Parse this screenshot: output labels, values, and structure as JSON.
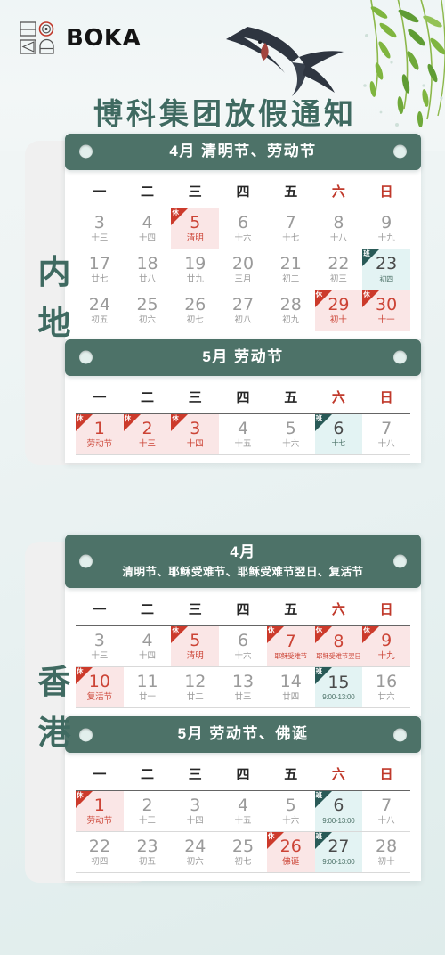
{
  "brand": {
    "name": "BOKA",
    "logo_icon": "boka-logo-icon"
  },
  "page_title": "博科集团放假通知",
  "decor": {
    "bird": "swallow-icon",
    "branch": "willow-branch-icon"
  },
  "badges": {
    "rest": "休",
    "work": "班"
  },
  "weekdays": [
    "一",
    "二",
    "三",
    "四",
    "五",
    "六",
    "日"
  ],
  "regions": [
    {
      "label": "内地",
      "calendars": [
        {
          "title_line1": "4月 清明节、劳动节",
          "title_line2": "",
          "weeks": [
            [
              {
                "num": "3",
                "sub": "十三"
              },
              {
                "num": "4",
                "sub": "十四"
              },
              {
                "num": "5",
                "sub": "清明",
                "type": "rest"
              },
              {
                "num": "6",
                "sub": "十六"
              },
              {
                "num": "7",
                "sub": "十七"
              },
              {
                "num": "8",
                "sub": "十八"
              },
              {
                "num": "9",
                "sub": "十九"
              }
            ],
            [
              {
                "num": "17",
                "sub": "廿七"
              },
              {
                "num": "18",
                "sub": "廿八"
              },
              {
                "num": "19",
                "sub": "廿九"
              },
              {
                "num": "20",
                "sub": "三月"
              },
              {
                "num": "21",
                "sub": "初二"
              },
              {
                "num": "22",
                "sub": "初三"
              },
              {
                "num": "23",
                "sub": "初四",
                "type": "work"
              }
            ],
            [
              {
                "num": "24",
                "sub": "初五"
              },
              {
                "num": "25",
                "sub": "初六"
              },
              {
                "num": "26",
                "sub": "初七"
              },
              {
                "num": "27",
                "sub": "初八"
              },
              {
                "num": "28",
                "sub": "初九"
              },
              {
                "num": "29",
                "sub": "初十",
                "type": "rest"
              },
              {
                "num": "30",
                "sub": "十一",
                "type": "rest"
              }
            ]
          ]
        },
        {
          "title_line1": "5月 劳动节",
          "title_line2": "",
          "weeks": [
            [
              {
                "num": "1",
                "sub": "劳动节",
                "type": "rest"
              },
              {
                "num": "2",
                "sub": "十三",
                "type": "rest"
              },
              {
                "num": "3",
                "sub": "十四",
                "type": "rest"
              },
              {
                "num": "4",
                "sub": "十五"
              },
              {
                "num": "5",
                "sub": "十六"
              },
              {
                "num": "6",
                "sub": "十七",
                "type": "work"
              },
              {
                "num": "7",
                "sub": "十八"
              }
            ]
          ]
        }
      ]
    },
    {
      "label": "香港",
      "calendars": [
        {
          "title_line1": "4月",
          "title_line2": "清明节、耶稣受难节、耶稣受难节翌日、复活节",
          "weeks": [
            [
              {
                "num": "3",
                "sub": "十三"
              },
              {
                "num": "4",
                "sub": "十四"
              },
              {
                "num": "5",
                "sub": "清明",
                "type": "rest"
              },
              {
                "num": "6",
                "sub": "十六"
              },
              {
                "num": "7",
                "sub": "耶稣受难节",
                "type": "rest",
                "size": "tiny"
              },
              {
                "num": "8",
                "sub": "耶稣受难节翌日",
                "type": "rest",
                "size": "two"
              },
              {
                "num": "9",
                "sub": "十九",
                "type": "rest"
              }
            ],
            [
              {
                "num": "10",
                "sub": "复活节",
                "type": "rest"
              },
              {
                "num": "11",
                "sub": "廿一"
              },
              {
                "num": "12",
                "sub": "廿二"
              },
              {
                "num": "13",
                "sub": "廿三"
              },
              {
                "num": "14",
                "sub": "廿四"
              },
              {
                "num": "15",
                "sub": "9:00-13:00",
                "type": "work"
              },
              {
                "num": "16",
                "sub": "廿六"
              }
            ]
          ]
        },
        {
          "title_line1": "5月 劳动节、佛诞",
          "title_line2": "",
          "weeks": [
            [
              {
                "num": "1",
                "sub": "劳动节",
                "type": "rest"
              },
              {
                "num": "2",
                "sub": "十三"
              },
              {
                "num": "3",
                "sub": "十四"
              },
              {
                "num": "4",
                "sub": "十五"
              },
              {
                "num": "5",
                "sub": "十六"
              },
              {
                "num": "6",
                "sub": "9:00-13:00",
                "type": "work"
              },
              {
                "num": "7",
                "sub": "十八"
              }
            ],
            [
              {
                "num": "22",
                "sub": "初四"
              },
              {
                "num": "23",
                "sub": "初五"
              },
              {
                "num": "24",
                "sub": "初六"
              },
              {
                "num": "25",
                "sub": "初七"
              },
              {
                "num": "26",
                "sub": "佛诞",
                "type": "rest"
              },
              {
                "num": "27",
                "sub": "9:00-13:00",
                "type": "work"
              },
              {
                "num": "28",
                "sub": "初十"
              }
            ]
          ]
        }
      ]
    }
  ],
  "colors": {
    "header_green": "#4d7268",
    "title_green": "#3f6a61",
    "rest_red": "#cc3a2b",
    "work_teal": "#295a57",
    "rest_bg": "#fae6e6",
    "work_bg": "#e3f3f3",
    "page_bg": "#e9f2f1"
  }
}
